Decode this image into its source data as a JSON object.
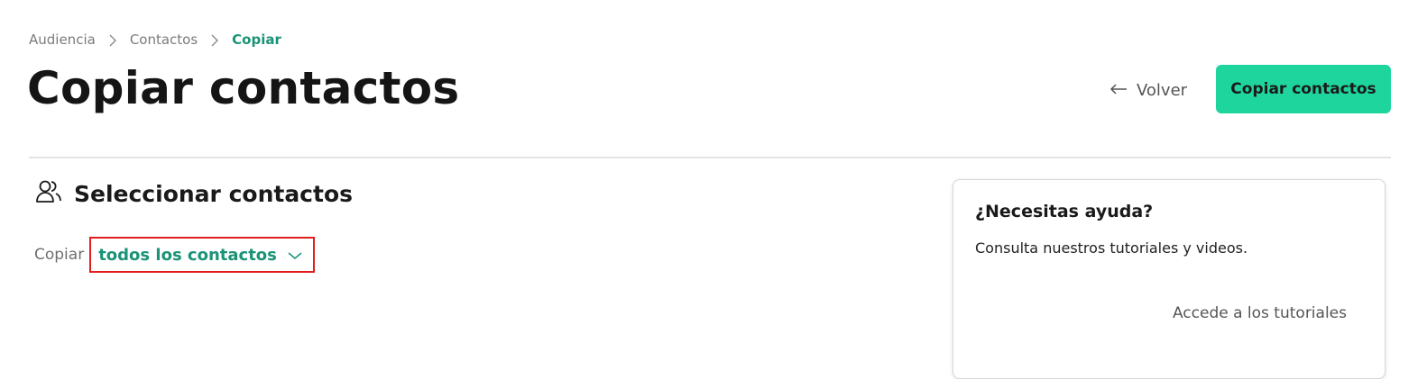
{
  "breadcrumb": {
    "items": [
      "Audiencia",
      "Contactos"
    ],
    "current": "Copiar"
  },
  "header": {
    "title": "Copiar contactos",
    "back_label": "Volver",
    "primary_label": "Copiar contactos"
  },
  "section": {
    "title": "Seleccionar contactos",
    "icon": "users-icon",
    "copy_label": "Copiar",
    "scope_value": "todos los contactos"
  },
  "help": {
    "title": "¿Necesitas ayuda?",
    "text": "Consulta nuestros tutoriales y videos.",
    "link": "Accede a los tutoriales"
  },
  "colors": {
    "accent": "#1b9377",
    "primary_button": "#1ed69d",
    "highlight_border": "#e21d1d"
  }
}
